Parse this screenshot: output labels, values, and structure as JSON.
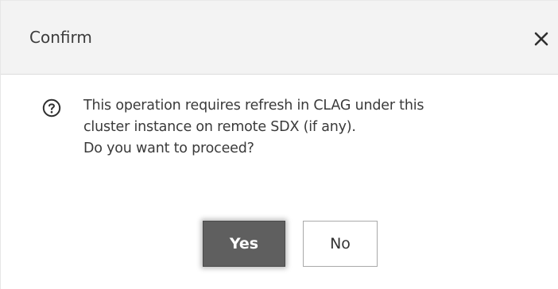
{
  "dialog": {
    "title": "Confirm",
    "close_icon": "close-icon",
    "help_icon": "question-circle-icon",
    "message_lines": [
      "This operation requires refresh in CLAG under this",
      "cluster instance on remote SDX (if any).",
      "Do you want to proceed?"
    ],
    "buttons": {
      "yes_label": "Yes",
      "no_label": "No"
    }
  },
  "colors": {
    "header_bg": "#f3f3f3",
    "primary_button_bg": "#5f5f5f",
    "text": "#3a3a3a"
  }
}
